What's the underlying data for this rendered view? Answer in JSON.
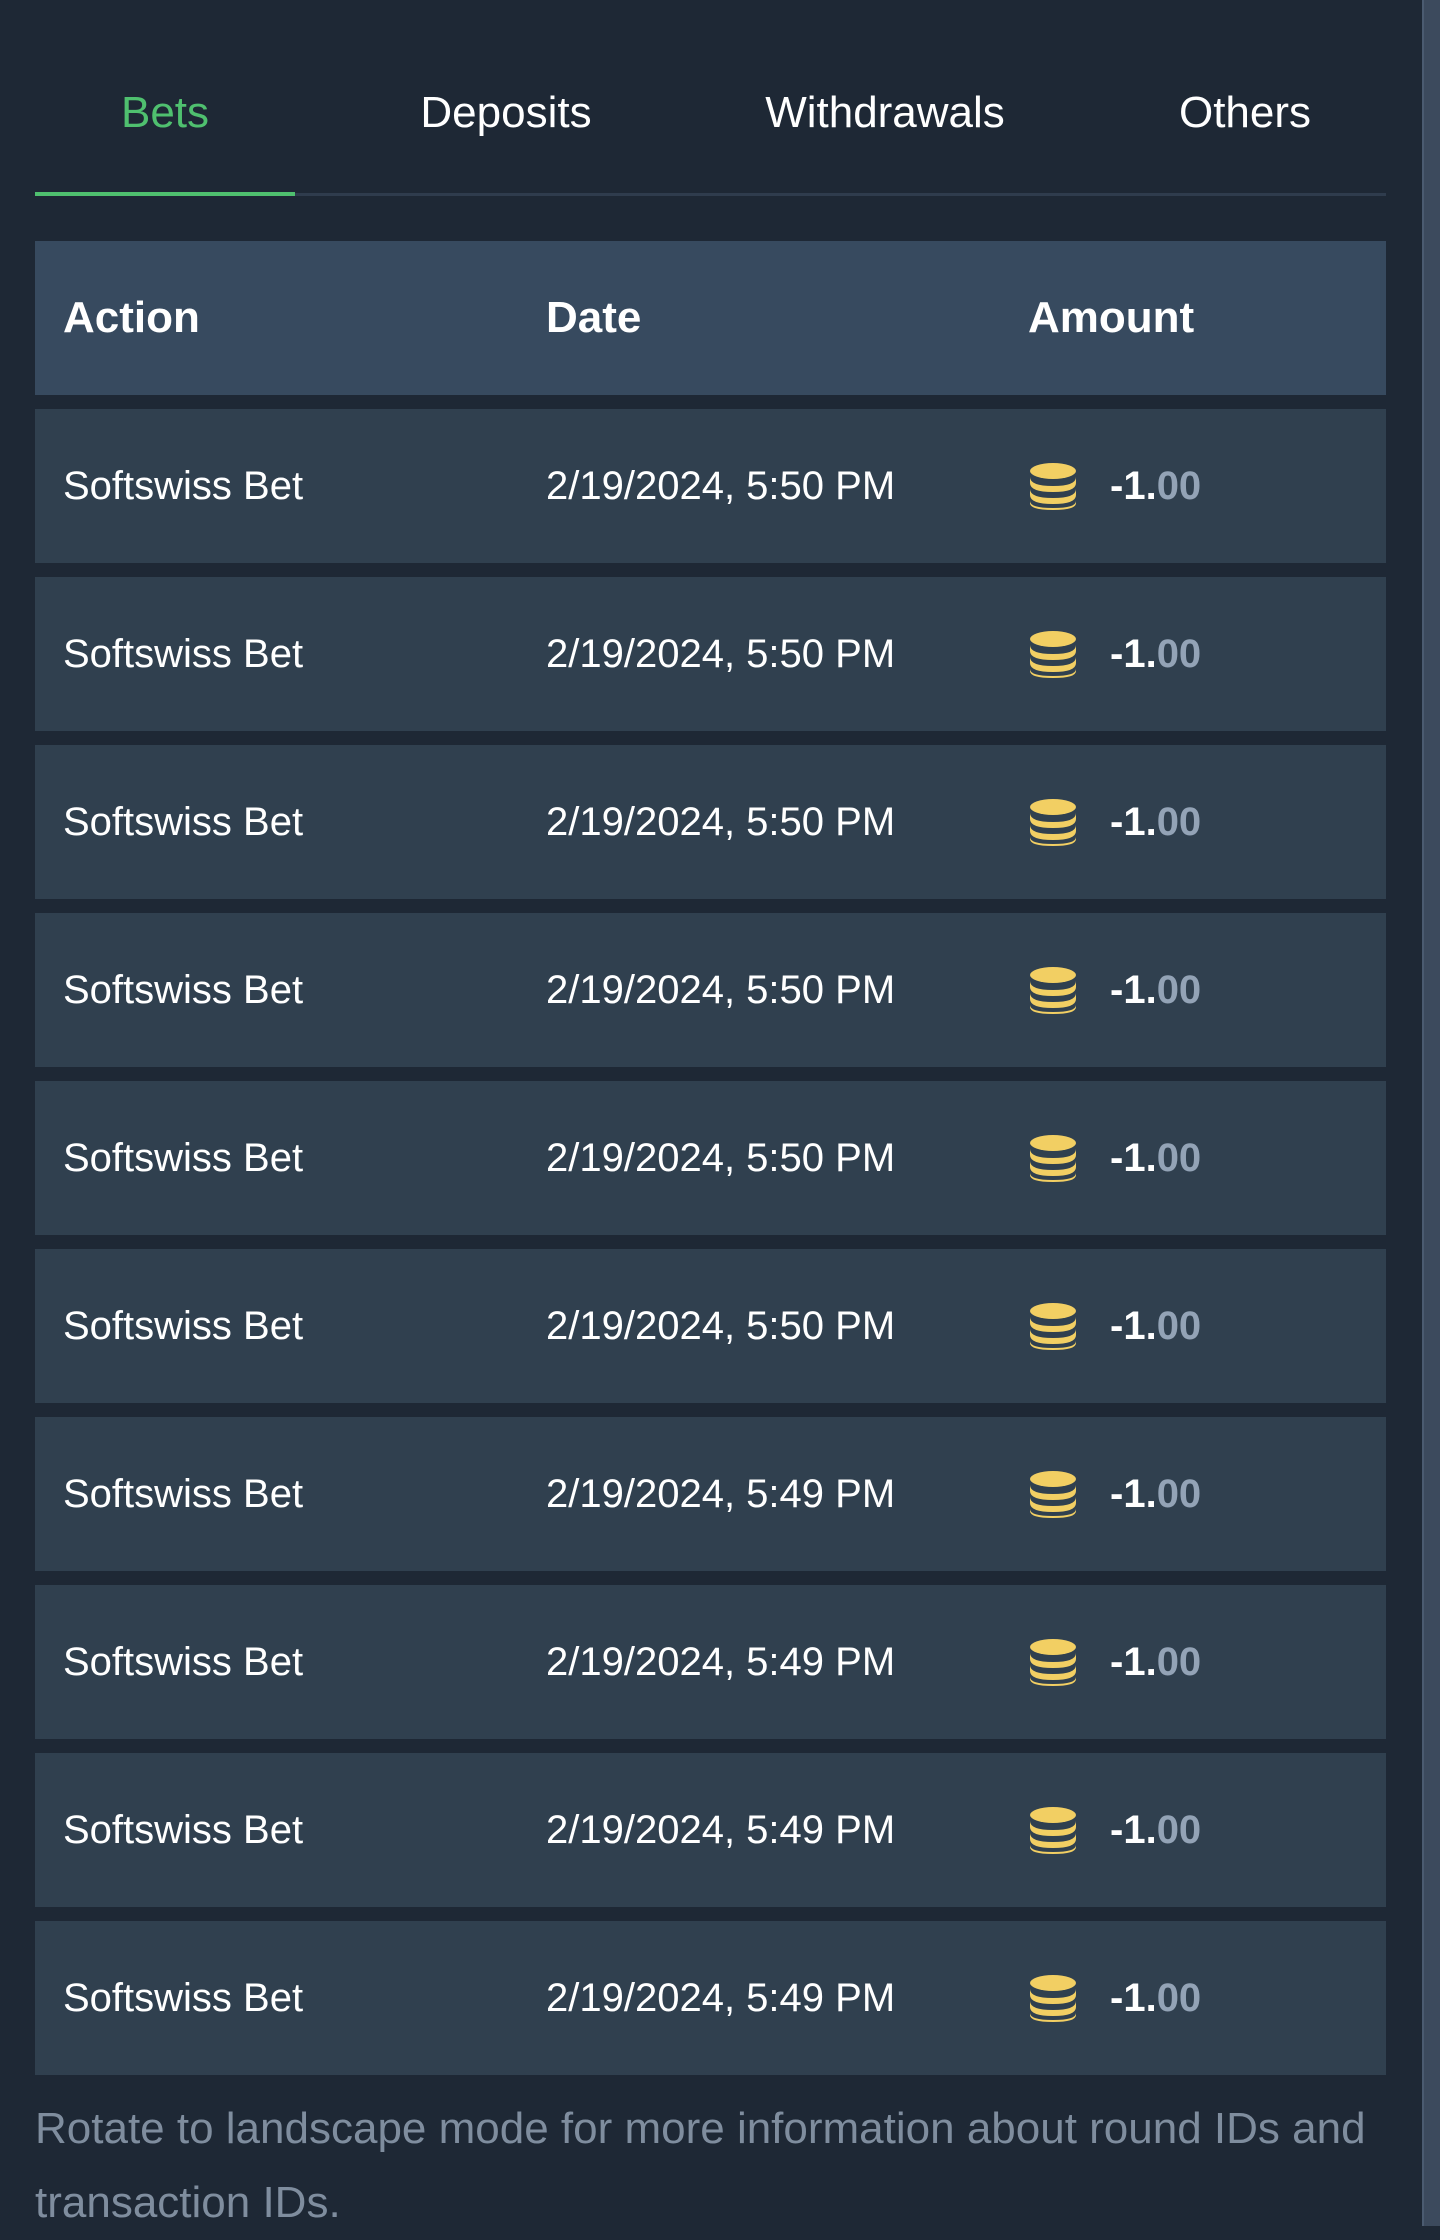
{
  "tabs": [
    {
      "label": "Bets",
      "active": true
    },
    {
      "label": "Deposits",
      "active": false
    },
    {
      "label": "Withdrawals",
      "active": false
    },
    {
      "label": "Others",
      "active": false
    }
  ],
  "table": {
    "headers": {
      "action": "Action",
      "date": "Date",
      "amount": "Amount"
    },
    "rows": [
      {
        "action": "Softswiss Bet",
        "date": "2/19/2024, 5:50 PM",
        "amount_int": "-1.",
        "amount_dec": "00",
        "icon": "coins-icon"
      },
      {
        "action": "Softswiss Bet",
        "date": "2/19/2024, 5:50 PM",
        "amount_int": "-1.",
        "amount_dec": "00",
        "icon": "coins-icon"
      },
      {
        "action": "Softswiss Bet",
        "date": "2/19/2024, 5:50 PM",
        "amount_int": "-1.",
        "amount_dec": "00",
        "icon": "coins-icon"
      },
      {
        "action": "Softswiss Bet",
        "date": "2/19/2024, 5:50 PM",
        "amount_int": "-1.",
        "amount_dec": "00",
        "icon": "coins-icon"
      },
      {
        "action": "Softswiss Bet",
        "date": "2/19/2024, 5:50 PM",
        "amount_int": "-1.",
        "amount_dec": "00",
        "icon": "coins-icon"
      },
      {
        "action": "Softswiss Bet",
        "date": "2/19/2024, 5:50 PM",
        "amount_int": "-1.",
        "amount_dec": "00",
        "icon": "coins-icon"
      },
      {
        "action": "Softswiss Bet",
        "date": "2/19/2024, 5:49 PM",
        "amount_int": "-1.",
        "amount_dec": "00",
        "icon": "coins-icon"
      },
      {
        "action": "Softswiss Bet",
        "date": "2/19/2024, 5:49 PM",
        "amount_int": "-1.",
        "amount_dec": "00",
        "icon": "coins-icon"
      },
      {
        "action": "Softswiss Bet",
        "date": "2/19/2024, 5:49 PM",
        "amount_int": "-1.",
        "amount_dec": "00",
        "icon": "coins-icon"
      },
      {
        "action": "Softswiss Bet",
        "date": "2/19/2024, 5:49 PM",
        "amount_int": "-1.",
        "amount_dec": "00",
        "icon": "coins-icon"
      }
    ]
  },
  "note": "Rotate to landscape mode for more information about round IDs and transaction IDs.",
  "colors": {
    "accent": "#4fc06f",
    "coin": "#f2cf63",
    "background": "#1e2835",
    "header_bg": "#374a5f",
    "row_bg": "#30404f",
    "muted_text": "#7f8d9e"
  }
}
